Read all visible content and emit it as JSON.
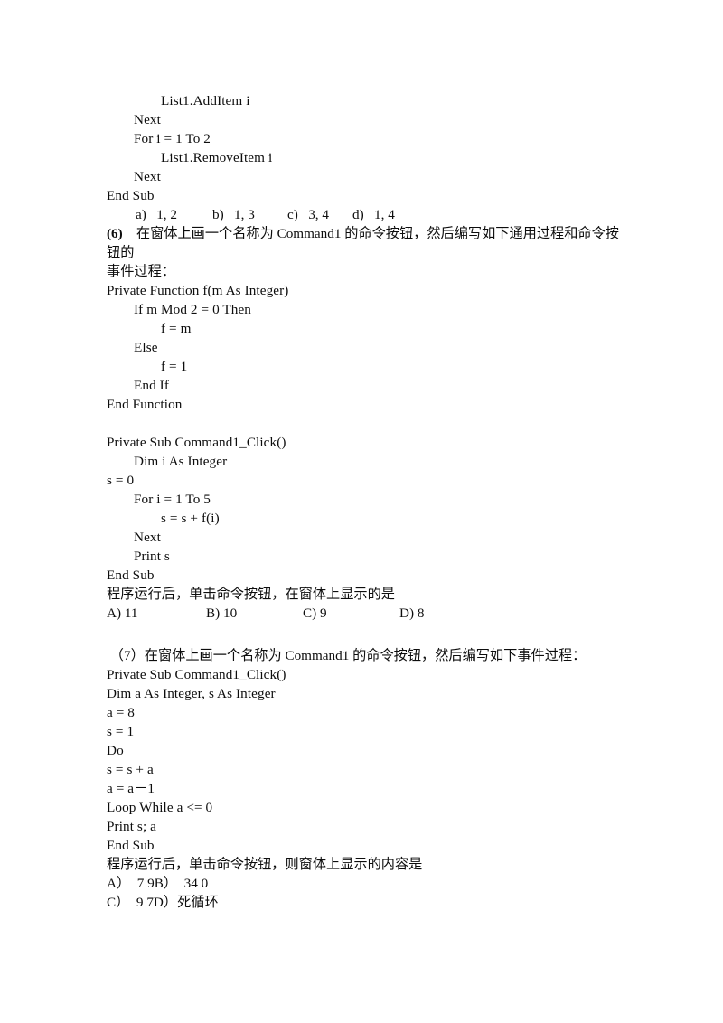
{
  "document": {
    "type": "exam-worksheet",
    "language": "zh-CN",
    "background_color": "#ffffff",
    "text_color": "#0d0d0d"
  },
  "block_prev_code": {
    "lines": [
      "List1.AddItem i",
      "Next",
      "For i = 1 To 2",
      "List1.RemoveItem i",
      "Next",
      "End Sub"
    ],
    "indents": [
      2,
      1,
      1,
      2,
      1,
      0
    ]
  },
  "block_prev_options": {
    "a_label": "a)",
    "a_value": "1, 2",
    "b_label": "b)",
    "b_value": "1, 3",
    "c_label": "c)",
    "c_value": "3, 4",
    "d_label": "d)",
    "d_value": "1, 4"
  },
  "question6": {
    "number": "(6)",
    "stem_line1": "在窗体上画一个名称为 Command1 的命令按钮，然后编写如下通用过程和命令按钮的",
    "stem_line2": "事件过程：",
    "function_code": [
      "Private Function f(m As Integer)",
      "If m Mod 2 = 0 Then",
      "f = m",
      "Else",
      "f = 1",
      "End If",
      "End Function"
    ],
    "function_indents": [
      0,
      1,
      2,
      1,
      2,
      1,
      0
    ],
    "sub_code": [
      "Private Sub Command1_Click()",
      "Dim i As Integer",
      "s = 0",
      "For i = 1 To 5",
      "s = s + f(i)",
      "Next",
      "Print s",
      "End Sub"
    ],
    "sub_indents": [
      0,
      1,
      0,
      1,
      2,
      1,
      1,
      0
    ],
    "prompt": "程序运行后，单击命令按钮，在窗体上显示的是",
    "options": [
      {
        "label": "A)",
        "value": "11"
      },
      {
        "label": "B)",
        "value": "10"
      },
      {
        "label": "C)",
        "value": "9"
      },
      {
        "label": "D)",
        "value": "8"
      }
    ]
  },
  "question7": {
    "number": "（7）",
    "stem": "在窗体上画一个名称为 Command1 的命令按钮，然后编写如下事件过程：",
    "code": [
      "Private Sub Command1_Click()",
      "Dim a As Integer, s As Integer",
      "a = 8",
      "s = 1",
      "Do",
      "s = s + a",
      "a = a－1",
      "Loop While a <= 0",
      "Print s; a",
      "End Sub"
    ],
    "code_indents": [
      0,
      0,
      0,
      0,
      0,
      0,
      0,
      0,
      0,
      0
    ],
    "prompt": "程序运行后，单击命令按钮，则窗体上显示的内容是",
    "options_row1": [
      {
        "label": "A）",
        "value": "7 9"
      },
      {
        "label": "B）",
        "value": "34 0"
      }
    ],
    "options_row2": [
      {
        "label": "C）",
        "value": "9 7"
      },
      {
        "label": "D）",
        "value": "死循环"
      }
    ]
  }
}
